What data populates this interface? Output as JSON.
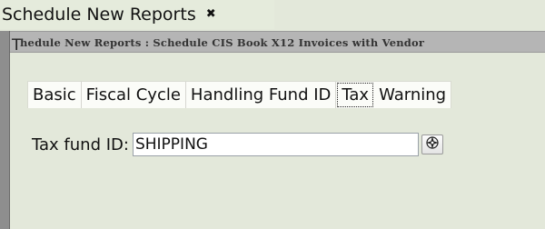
{
  "window": {
    "tab_title": "Schedule New Reports",
    "close_glyph": "✖"
  },
  "breadcrumb": {
    "first_char": "T",
    "text": "hedule New Reports : Schedule CIS Book X12 Invoices with Vendor"
  },
  "tabs": [
    {
      "label": "Basic",
      "active": false
    },
    {
      "label": "Fiscal Cycle",
      "active": false
    },
    {
      "label": "Handling Fund ID",
      "active": false
    },
    {
      "label": "Tax",
      "active": true
    },
    {
      "label": "Warning",
      "active": false
    }
  ],
  "form": {
    "tax_fund_label": "Tax fund ID:",
    "tax_fund_value": "SHIPPING",
    "lookup_icon": "crosshair-lookup-icon"
  },
  "colors": {
    "background": "#e3e8da",
    "crumb_bar": "#b5b5b5",
    "left_bar": "#8e8e8e"
  }
}
